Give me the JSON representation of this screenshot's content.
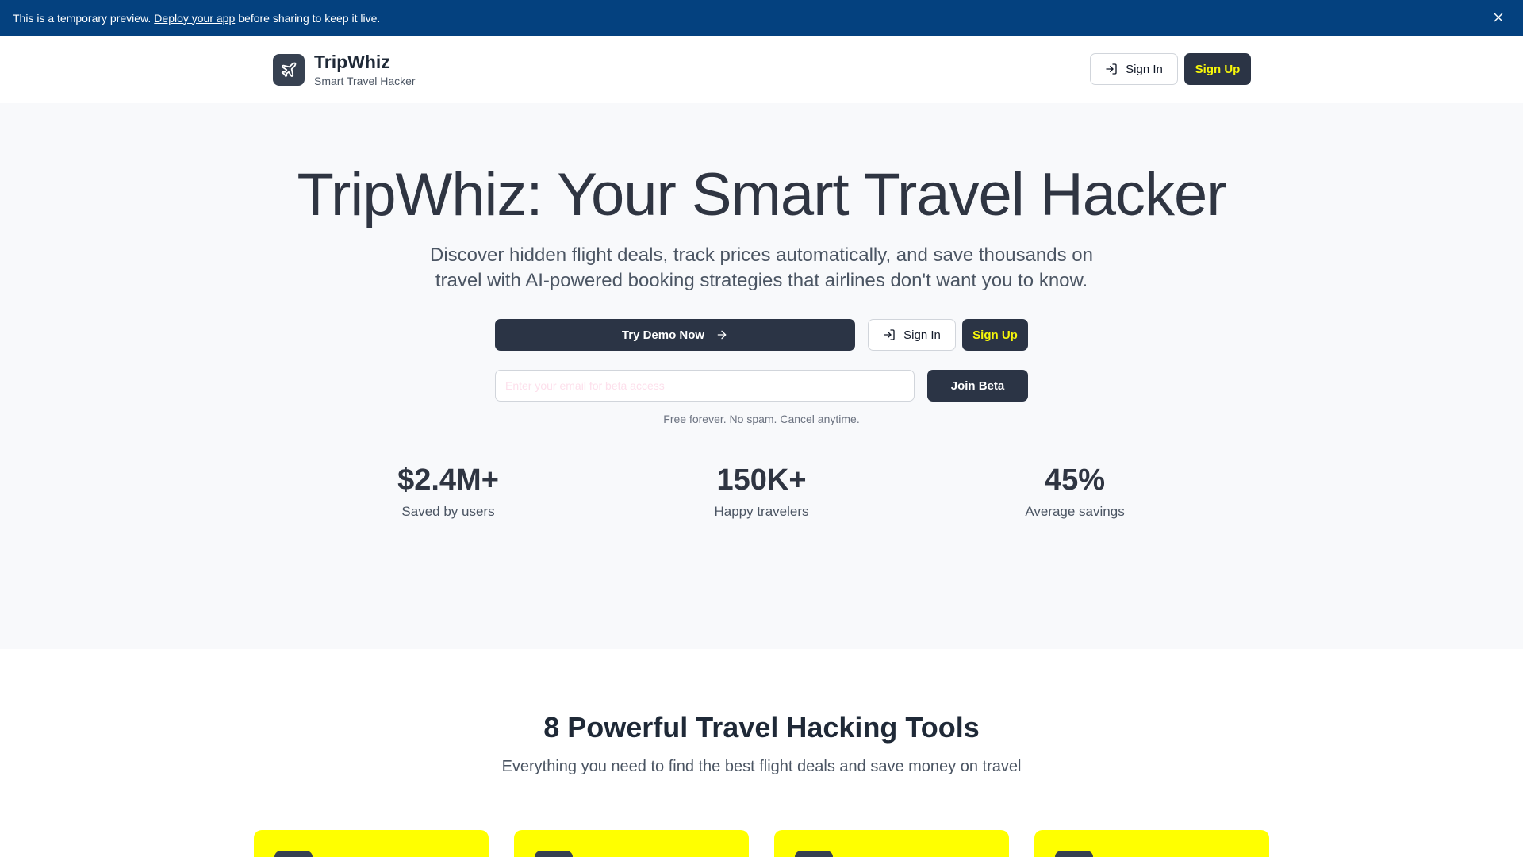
{
  "banner": {
    "text_before": "This is a temporary preview.",
    "link": "Deploy your app",
    "text_after": "before sharing to keep it live."
  },
  "header": {
    "brand_name": "TripWhiz",
    "tagline": "Smart Travel Hacker",
    "signin_label": "Sign In",
    "signup_label": "Sign Up"
  },
  "hero": {
    "title": "TripWhiz: Your Smart Travel Hacker",
    "subtitle": "Discover hidden flight deals, track prices automatically, and save thousands on travel with AI-powered booking strategies that airlines don't want you to know.",
    "demo_label": "Try Demo Now",
    "signin_label": "Sign In",
    "signup_label": "Sign Up",
    "email_placeholder": "Enter your email for beta access",
    "join_label": "Join Beta",
    "fine_print": "Free forever. No spam. Cancel anytime."
  },
  "stats": [
    {
      "value": "$2.4M+",
      "label": "Saved by users"
    },
    {
      "value": "150K+",
      "label": "Happy travelers"
    },
    {
      "value": "45%",
      "label": "Average savings"
    }
  ],
  "tools": {
    "title": "8 Powerful Travel Hacking Tools",
    "subtitle": "Everything you need to find the best flight deals and save money on travel"
  },
  "colors": {
    "banner": "#04417f",
    "primary": "#2b3445",
    "accent_yellow": "#f7f70a",
    "card_yellow": "#ffff00"
  },
  "icons": [
    "plane-icon",
    "sign-in-icon",
    "arrow-right-icon",
    "close-icon"
  ]
}
